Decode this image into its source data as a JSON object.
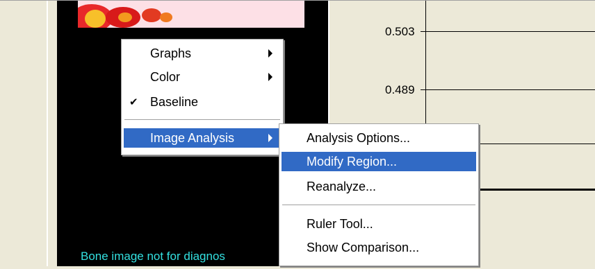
{
  "image_panel": {
    "caption": "Bone image not for diagnos"
  },
  "chart": {
    "tick_labels": [
      "0.503",
      "0.489"
    ]
  },
  "context_menu": {
    "items": [
      {
        "label": "Graphs",
        "has_submenu": true
      },
      {
        "label": "Color",
        "has_submenu": true
      },
      {
        "label": "Baseline",
        "checked": true
      },
      {
        "label": "Image Analysis",
        "has_submenu": true,
        "selected": true
      }
    ]
  },
  "submenu": {
    "items": [
      {
        "label": "Analysis Options..."
      },
      {
        "label": "Modify Region...",
        "selected": true
      },
      {
        "label": "Reanalyze..."
      },
      {
        "label": "Ruler Tool..."
      },
      {
        "label": "Show Comparison..."
      }
    ]
  },
  "colors": {
    "selection": "#316ac5",
    "caption": "#33e0e0",
    "window_bg": "#ece9d8"
  }
}
